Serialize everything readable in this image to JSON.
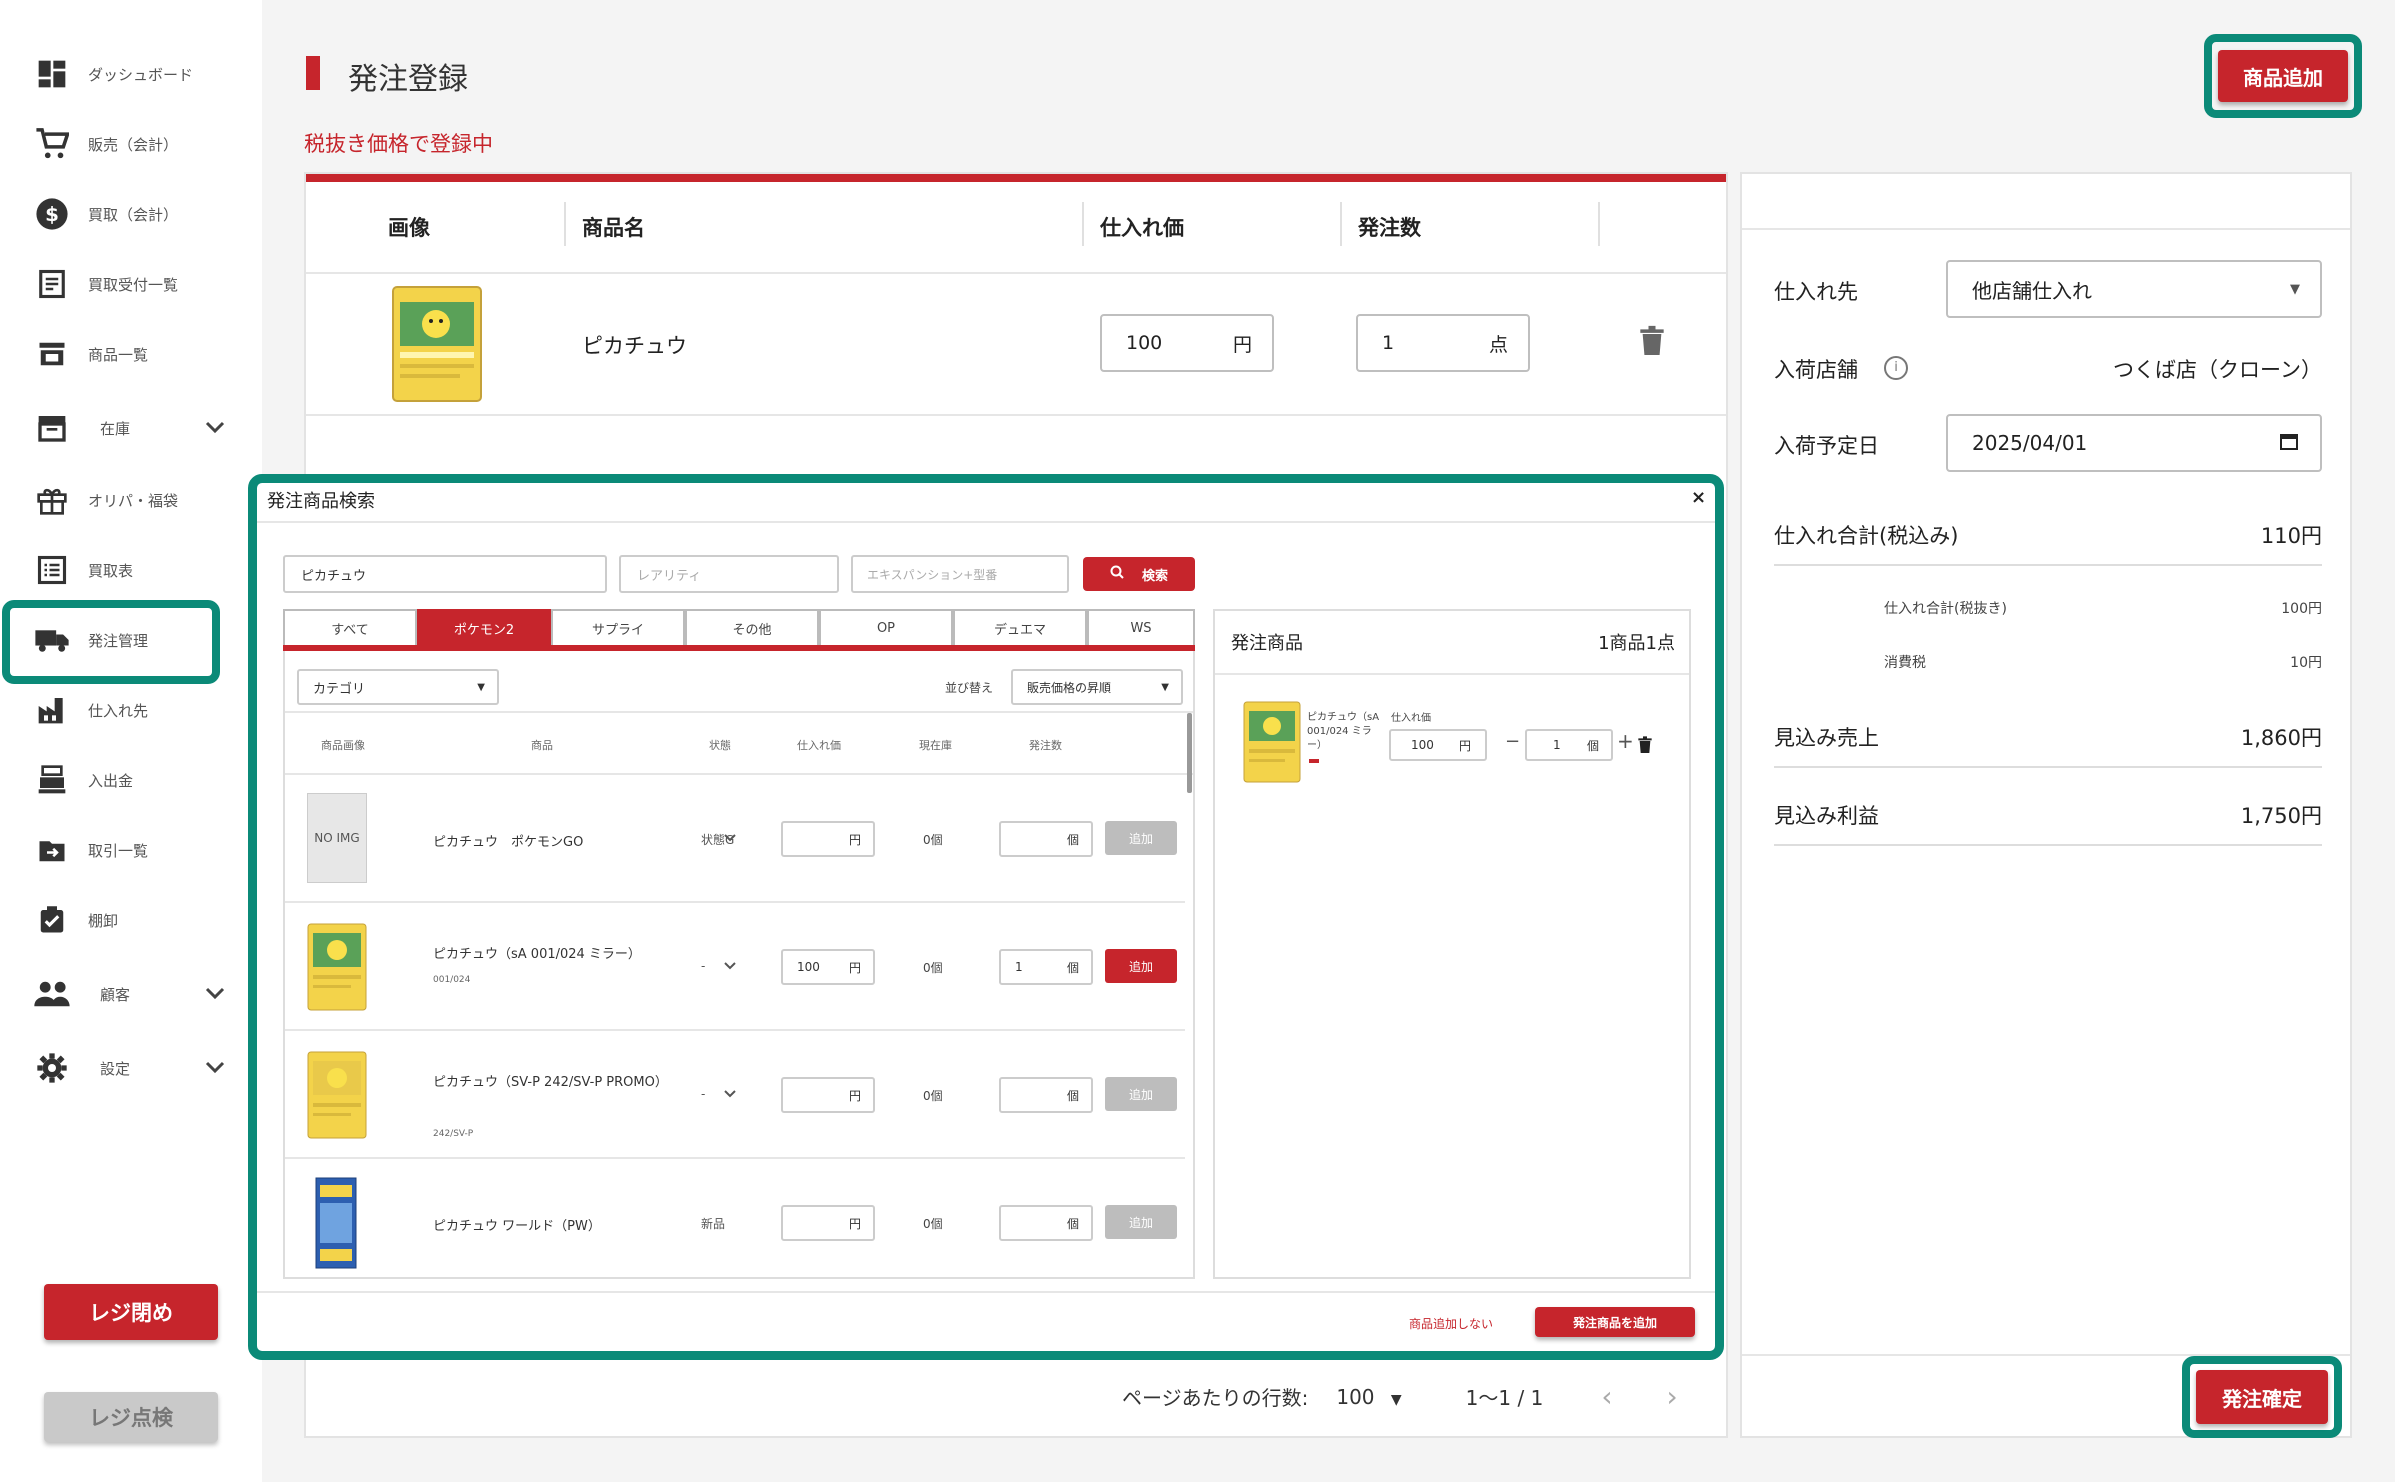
{
  "sidebar": {
    "items": [
      {
        "label": "ダッシュボード",
        "icon": "dashboard-icon"
      },
      {
        "label": "販売（会計）",
        "icon": "cart-icon"
      },
      {
        "label": "買取（会計）",
        "icon": "dollar-icon"
      },
      {
        "label": "買取受付一覧",
        "icon": "receipt-icon"
      },
      {
        "label": "商品一覧",
        "icon": "store-icon"
      },
      {
        "label": "在庫",
        "icon": "archive-icon"
      },
      {
        "label": "オリパ・福袋",
        "icon": "gift-icon"
      },
      {
        "label": "買取表",
        "icon": "list-icon"
      },
      {
        "label": "発注管理",
        "icon": "truck-icon"
      },
      {
        "label": "仕入れ先",
        "icon": "factory-icon"
      },
      {
        "label": "入出金",
        "icon": "register-icon"
      },
      {
        "label": "取引一覧",
        "icon": "transfer-icon"
      },
      {
        "label": "棚卸",
        "icon": "clipboard-icon"
      },
      {
        "label": "顧客",
        "icon": "people-icon"
      },
      {
        "label": "設定",
        "icon": "gear-icon"
      }
    ],
    "register_close": "レジ閉め",
    "register_check": "レジ点検"
  },
  "header": {
    "title": "発注登録",
    "subtitle": "税抜き価格で登録中",
    "add_product": "商品追加"
  },
  "order_table": {
    "headers": [
      "画像",
      "商品名",
      "仕入れ価",
      "発注数"
    ],
    "rows": [
      {
        "name": "ピカチュウ",
        "price": "100",
        "price_unit": "円",
        "qty": "1",
        "qty_unit": "点"
      }
    ],
    "pagination": {
      "rows_label": "ページあたりの行数:",
      "rows_value": "100",
      "range": "1～1 / 1"
    }
  },
  "summary": {
    "supplier_label": "仕入れ先",
    "supplier_value": "他店舗仕入れ",
    "store_label": "入荷店舗",
    "store_value": "つくば店（クローン）",
    "date_label": "入荷予定日",
    "date_value": "2025/04/01",
    "total_label": "仕入れ合計(税込み)",
    "total_value": "110円",
    "subtotal_label": "仕入れ合計(税抜き)",
    "subtotal_value": "100円",
    "tax_label": "消費税",
    "tax_value": "10円",
    "sales_label": "見込み売上",
    "sales_value": "1,860円",
    "profit_label": "見込み利益",
    "profit_value": "1,750円",
    "confirm": "発注確定"
  },
  "modal": {
    "title": "発注商品検索",
    "close": "×",
    "search_value": "ピカチュウ",
    "rarity_placeholder": "レアリティ",
    "expansion_placeholder": "エキスパンション+型番",
    "search_button": "検索",
    "tabs": [
      "すべて",
      "ポケモン2",
      "サプライ",
      "その他",
      "OP",
      "デュエマ",
      "WS"
    ],
    "category": "カテゴリ",
    "sort_label": "並び替え",
    "sort_value": "販売価格の昇順",
    "columns": [
      "商品画像",
      "商品",
      "状態",
      "仕入れ価",
      "現在庫",
      "発注数"
    ],
    "rows": [
      {
        "noimg": "NO IMG",
        "name": "ピカチュウ　ポケモンGO",
        "code": "",
        "state": "状態G",
        "price": "",
        "stock": "0個",
        "qty": "",
        "add": "追加",
        "active": false
      },
      {
        "noimg": "",
        "name": "ピカチュウ（sA 001/024 ミラー）",
        "code": "001/024",
        "state": "-",
        "price": "100",
        "stock": "0個",
        "qty": "1",
        "add": "追加",
        "active": true
      },
      {
        "noimg": "",
        "name": "ピカチュウ（SV-P 242/SV-P PROMO）",
        "code": "242/SV-P",
        "state": "-",
        "price": "",
        "stock": "0個",
        "qty": "",
        "add": "追加",
        "active": false
      },
      {
        "noimg": "",
        "name": "ピカチュウ ワールド（PW）",
        "code": "",
        "state": "新品",
        "price": "",
        "stock": "0個",
        "qty": "",
        "add": "追加",
        "active": false
      }
    ],
    "yen": "円",
    "ko": "個",
    "cart_title": "発注商品",
    "cart_count": "1商品1点",
    "cart_item": {
      "name": "ピカチュウ（sA 001/024 ミラー）",
      "price_label": "仕入れ価",
      "price": "100",
      "qty": "1"
    },
    "cancel": "商品追加しない",
    "add_order": "発注商品を追加"
  },
  "colors": {
    "accent": "#c6252c",
    "highlight": "#0b8a78"
  }
}
